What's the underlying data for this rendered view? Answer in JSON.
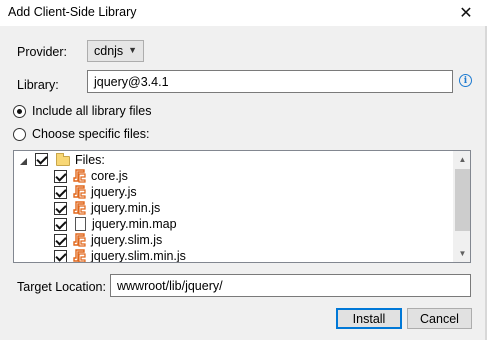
{
  "window": {
    "title": "Add Client-Side Library",
    "close_glyph": "✕"
  },
  "provider": {
    "label": "Provider:",
    "value": "cdnjs"
  },
  "library": {
    "label": "Library:",
    "value": "jquery@3.4.1",
    "info_glyph": "i"
  },
  "radios": {
    "include_all": {
      "label": "Include all library files",
      "selected": true
    },
    "choose_specific": {
      "label": "Choose specific files:",
      "selected": false
    }
  },
  "files_tree": {
    "root": {
      "label": "Files:",
      "checked": true
    },
    "items": [
      {
        "name": "core.js",
        "icon": "js-file-icon",
        "checked": true
      },
      {
        "name": "jquery.js",
        "icon": "js-file-icon",
        "checked": true
      },
      {
        "name": "jquery.min.js",
        "icon": "js-file-icon",
        "checked": true
      },
      {
        "name": "jquery.min.map",
        "icon": "map-file-icon",
        "checked": true
      },
      {
        "name": "jquery.slim.js",
        "icon": "js-file-icon",
        "checked": true
      },
      {
        "name": "jquery.slim.min.js",
        "icon": "js-file-icon",
        "checked": true
      }
    ]
  },
  "target": {
    "label": "Target Location:",
    "value": "wwwroot/lib/jquery/"
  },
  "buttons": {
    "install": "Install",
    "cancel": "Cancel"
  },
  "colors": {
    "accent": "#0078d7",
    "js_icon": "#e0661a",
    "info": "#1e7bd1"
  }
}
